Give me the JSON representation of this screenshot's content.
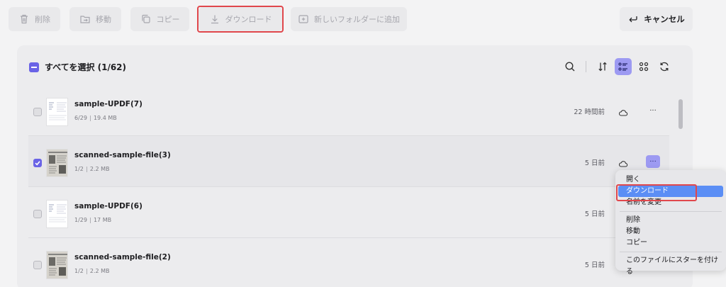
{
  "toolbar": {
    "delete_label": "削除",
    "move_label": "移動",
    "copy_label": "コピー",
    "download_label": "ダウンロード",
    "new_folder_label": "新しいフォルダーに追加",
    "cancel_label": "キャンセル"
  },
  "panel": {
    "select_all_label": "すべてを選択 (1/62)"
  },
  "files": [
    {
      "name": "sample-UPDF(7)",
      "pages": "6/29",
      "size": "19.4 MB",
      "time": "22 時間前",
      "checked": false
    },
    {
      "name": "scanned-sample-file(3)",
      "pages": "1/2",
      "size": "2.2 MB",
      "time": "5 日前",
      "checked": true
    },
    {
      "name": "sample-UPDF(6)",
      "pages": "1/29",
      "size": "17 MB",
      "time": "5 日前",
      "checked": false
    },
    {
      "name": "scanned-sample-file(2)",
      "pages": "1/2",
      "size": "2.2 MB",
      "time": "5 日前",
      "checked": false
    }
  ],
  "context_menu": {
    "open": "開く",
    "download": "ダウンロード",
    "rename": "名前を変更",
    "delete": "削除",
    "move": "移動",
    "copy": "コピー",
    "star": "このファイルにスターを付ける"
  },
  "colors": {
    "accent": "#6a63e6",
    "active_tool": "#9d9af2",
    "menu_hover": "#5b8ef5",
    "highlight_frame": "#e0474c"
  }
}
